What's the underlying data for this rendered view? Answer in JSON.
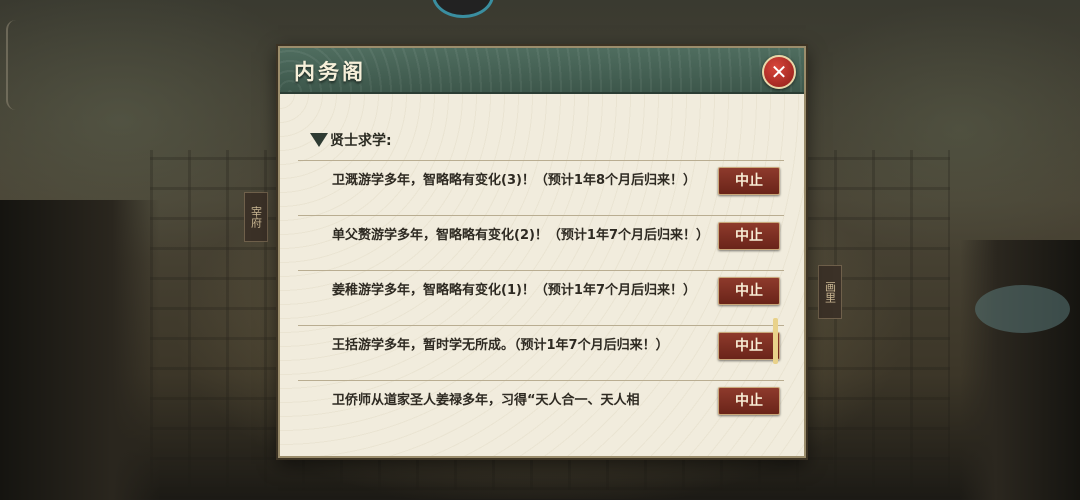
{
  "dialog": {
    "title": "内务阁",
    "close_symbol": "✕",
    "section_title": "贤士求学:",
    "stop_label": "中止",
    "rows": [
      {
        "text": "卫溉游学多年，智略略有变化(3)！（预计1年8个月后归来！）"
      },
      {
        "text": "单父赘游学多年，智略略有变化(2)！（预计1年7个月后归来！）"
      },
      {
        "text": "姜稚游学多年，智略略有变化(1)！（预计1年7个月后归来！）"
      },
      {
        "text": "王括游学多年，暂时学无所成。（预计1年7个月后归来！）"
      },
      {
        "text": "卫侨师从道家圣人姜禄多年，习得“天人合一、天人相"
      }
    ]
  },
  "map": {
    "tag_left": "宰府",
    "tag_right": "画里"
  },
  "colors": {
    "title_bar": "#4f6d5f",
    "stop_button": "#8e3a2c",
    "panel": "#f1ecdd"
  }
}
